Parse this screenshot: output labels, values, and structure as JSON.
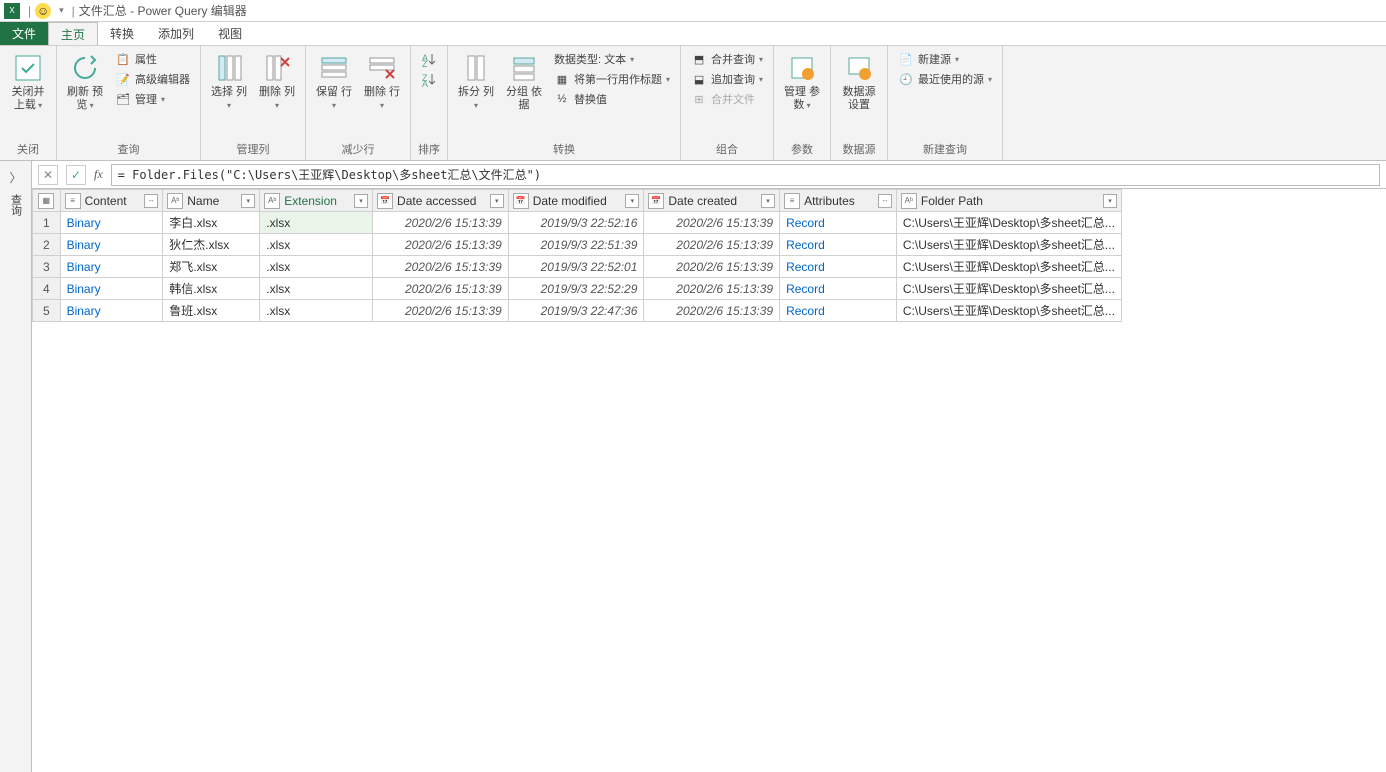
{
  "title": "文件汇总 - Power Query 编辑器",
  "tabs": {
    "file": "文件",
    "home": "主页",
    "transform": "转换",
    "addcol": "添加列",
    "view": "视图"
  },
  "ribbon": {
    "close_load": "关闭并\n上载",
    "close_group": "关闭",
    "refresh": "刷新\n预览",
    "properties": "属性",
    "advanced": "高级编辑器",
    "manage": "管理",
    "query_group": "查询",
    "choose_cols": "选择\n列",
    "remove_cols": "删除\n列",
    "manage_cols_group": "管理列",
    "keep_rows": "保留\n行",
    "remove_rows": "删除\n行",
    "reduce_rows_group": "减少行",
    "sort_group": "排序",
    "split_col": "拆分\n列",
    "group_by": "分组\n依据",
    "data_type": "数据类型: 文本",
    "first_row": "将第一行用作标题",
    "replace": "替换值",
    "transform_group": "转换",
    "merge_q": "合并查询",
    "append_q": "追加查询",
    "combine_files": "合并文件",
    "combine_group": "组合",
    "manage_params": "管理\n参数",
    "params_group": "参数",
    "ds_settings": "数据源\n设置",
    "ds_group": "数据源",
    "new_source": "新建源",
    "recent_source": "最近使用的源",
    "new_query_group": "新建查询"
  },
  "sidebar_label": "查询",
  "formula": "= Folder.Files(\"C:\\Users\\王亚辉\\Desktop\\多sheet汇总\\文件汇总\")",
  "columns": {
    "content": "Content",
    "name": "Name",
    "extension": "Extension",
    "date_accessed": "Date accessed",
    "date_modified": "Date modified",
    "date_created": "Date created",
    "attributes": "Attributes",
    "folder_path": "Folder Path"
  },
  "rows": [
    {
      "n": "1",
      "content": "Binary",
      "name": "李白.xlsx",
      "ext": ".xlsx",
      "acc": "2020/2/6 15:13:39",
      "mod": "2019/9/3 22:52:16",
      "cre": "2020/2/6 15:13:39",
      "attr": "Record",
      "path": "C:\\Users\\王亚辉\\Desktop\\多sheet汇总..."
    },
    {
      "n": "2",
      "content": "Binary",
      "name": "狄仁杰.xlsx",
      "ext": ".xlsx",
      "acc": "2020/2/6 15:13:39",
      "mod": "2019/9/3 22:51:39",
      "cre": "2020/2/6 15:13:39",
      "attr": "Record",
      "path": "C:\\Users\\王亚辉\\Desktop\\多sheet汇总..."
    },
    {
      "n": "3",
      "content": "Binary",
      "name": "郑飞.xlsx",
      "ext": ".xlsx",
      "acc": "2020/2/6 15:13:39",
      "mod": "2019/9/3 22:52:01",
      "cre": "2020/2/6 15:13:39",
      "attr": "Record",
      "path": "C:\\Users\\王亚辉\\Desktop\\多sheet汇总..."
    },
    {
      "n": "4",
      "content": "Binary",
      "name": "韩信.xlsx",
      "ext": ".xlsx",
      "acc": "2020/2/6 15:13:39",
      "mod": "2019/9/3 22:52:29",
      "cre": "2020/2/6 15:13:39",
      "attr": "Record",
      "path": "C:\\Users\\王亚辉\\Desktop\\多sheet汇总..."
    },
    {
      "n": "5",
      "content": "Binary",
      "name": "鲁班.xlsx",
      "ext": ".xlsx",
      "acc": "2020/2/6 15:13:39",
      "mod": "2019/9/3 22:47:36",
      "cre": "2020/2/6 15:13:39",
      "attr": "Record",
      "path": "C:\\Users\\王亚辉\\Desktop\\多sheet汇总..."
    }
  ]
}
